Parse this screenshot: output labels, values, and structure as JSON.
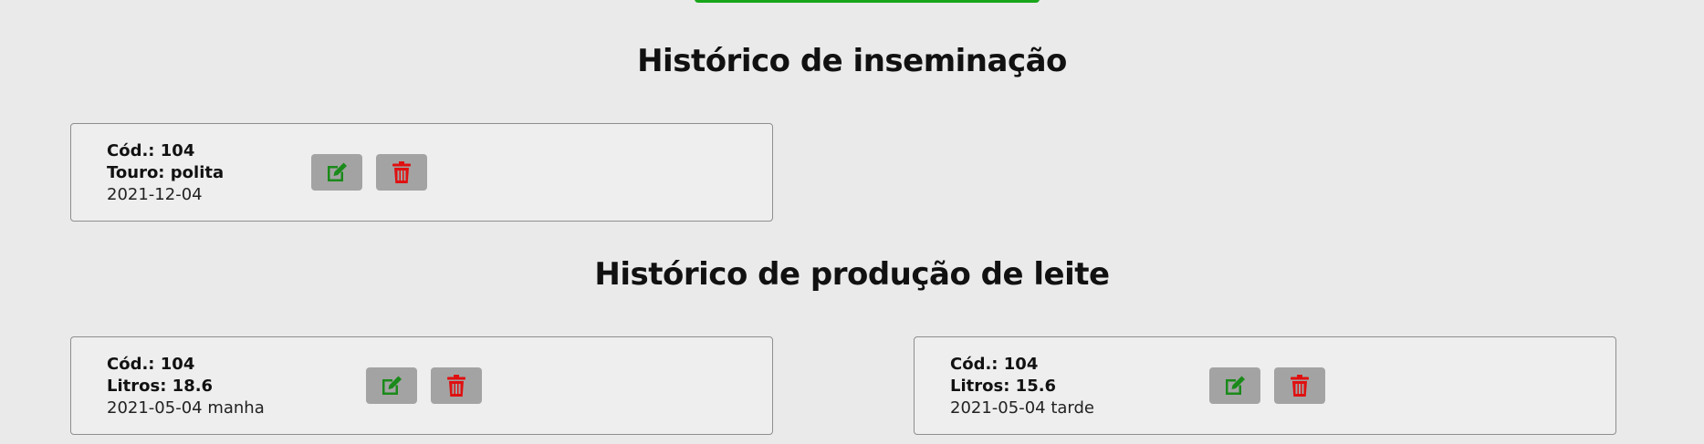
{
  "colors": {
    "background": "#eaeaea",
    "accent_green": "#19a61a",
    "edit_icon": "#1a8a1a",
    "delete_icon": "#e01010",
    "button_bg": "#a3a3a3"
  },
  "insemination": {
    "title": "Histórico de inseminação",
    "records": [
      {
        "code": "Cód.: 104",
        "detail": "Touro: polita",
        "date": "2021-12-04",
        "edit_icon": "edit-icon",
        "delete_icon": "trash-icon"
      }
    ]
  },
  "milk": {
    "title": "Histórico de produção de leite",
    "records": [
      {
        "code": "Cód.: 104",
        "detail": "Litros: 18.6",
        "date": "2021-05-04 manha",
        "edit_icon": "edit-icon",
        "delete_icon": "trash-icon"
      },
      {
        "code": "Cód.: 104",
        "detail": "Litros: 15.6",
        "date": "2021-05-04 tarde",
        "edit_icon": "edit-icon",
        "delete_icon": "trash-icon"
      }
    ]
  }
}
